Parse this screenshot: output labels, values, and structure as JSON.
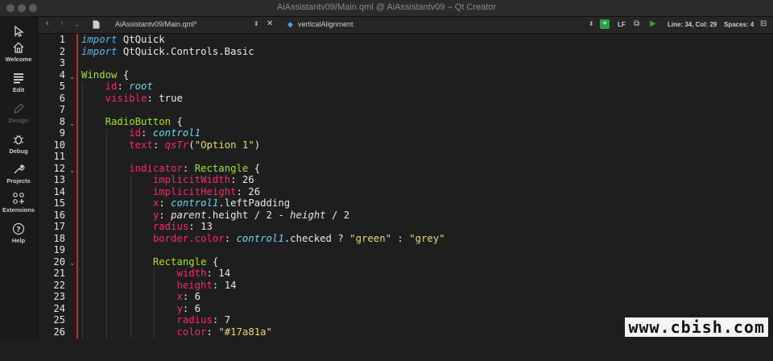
{
  "window": {
    "title": "AiAssistantv09/Main.qml @ AiAssistantv09 – Qt Creator"
  },
  "sidebar": {
    "items": [
      {
        "label": "Welcome",
        "icon": "home-icon"
      },
      {
        "label": "Edit",
        "icon": "edit-icon"
      },
      {
        "label": "Design",
        "icon": "design-icon"
      },
      {
        "label": "Debug",
        "icon": "debug-icon"
      },
      {
        "label": "Projects",
        "icon": "projects-icon"
      },
      {
        "label": "Extensions",
        "icon": "extensions-icon"
      },
      {
        "label": "Help",
        "icon": "help-icon"
      }
    ]
  },
  "toolbar": {
    "file_name": "AiAssistantv09/Main.qml*",
    "symbol": "verticalAlignment",
    "line_ending": "LF",
    "position": "Line: 34, Col: 29",
    "spaces": "Spaces: 4"
  },
  "editor": {
    "line_numbers": [
      "1",
      "2",
      "3",
      "4",
      "5",
      "6",
      "7",
      "8",
      "9",
      "10",
      "11",
      "12",
      "13",
      "14",
      "15",
      "16",
      "17",
      "18",
      "19",
      "20",
      "21",
      "22",
      "23",
      "24",
      "25",
      "26"
    ]
  },
  "watermark": "www.cbish.com",
  "colors": {
    "keyword": "#5fb3e6",
    "type": "#a6e22e",
    "property": "#f92672",
    "string": "#e6db74",
    "change_bar": "#c4302b"
  }
}
